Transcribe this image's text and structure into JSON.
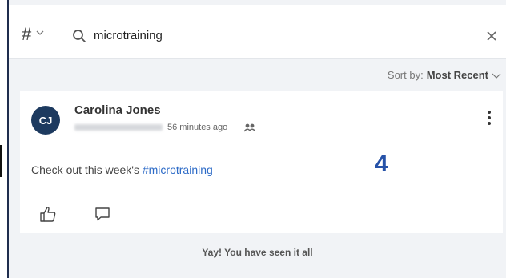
{
  "search": {
    "filter_icon": "hash-icon",
    "value": "microtraining",
    "clear_icon": "close-icon"
  },
  "sort": {
    "label": "Sort by:",
    "value": "Most Recent"
  },
  "post": {
    "avatar_initials": "CJ",
    "author": "Carolina Jones",
    "timestamp": "56 minutes ago",
    "text_prefix": "Check out this week's ",
    "hashtag": "#microtraining"
  },
  "feed": {
    "end_message": "Yay! You have seen it all"
  },
  "annotation": {
    "step": "4"
  },
  "colors": {
    "accent": "#2d6bc7",
    "avatar_bg": "#1d3a5f",
    "step_number": "#2652a8",
    "panel_bg": "#f1f3f6"
  }
}
